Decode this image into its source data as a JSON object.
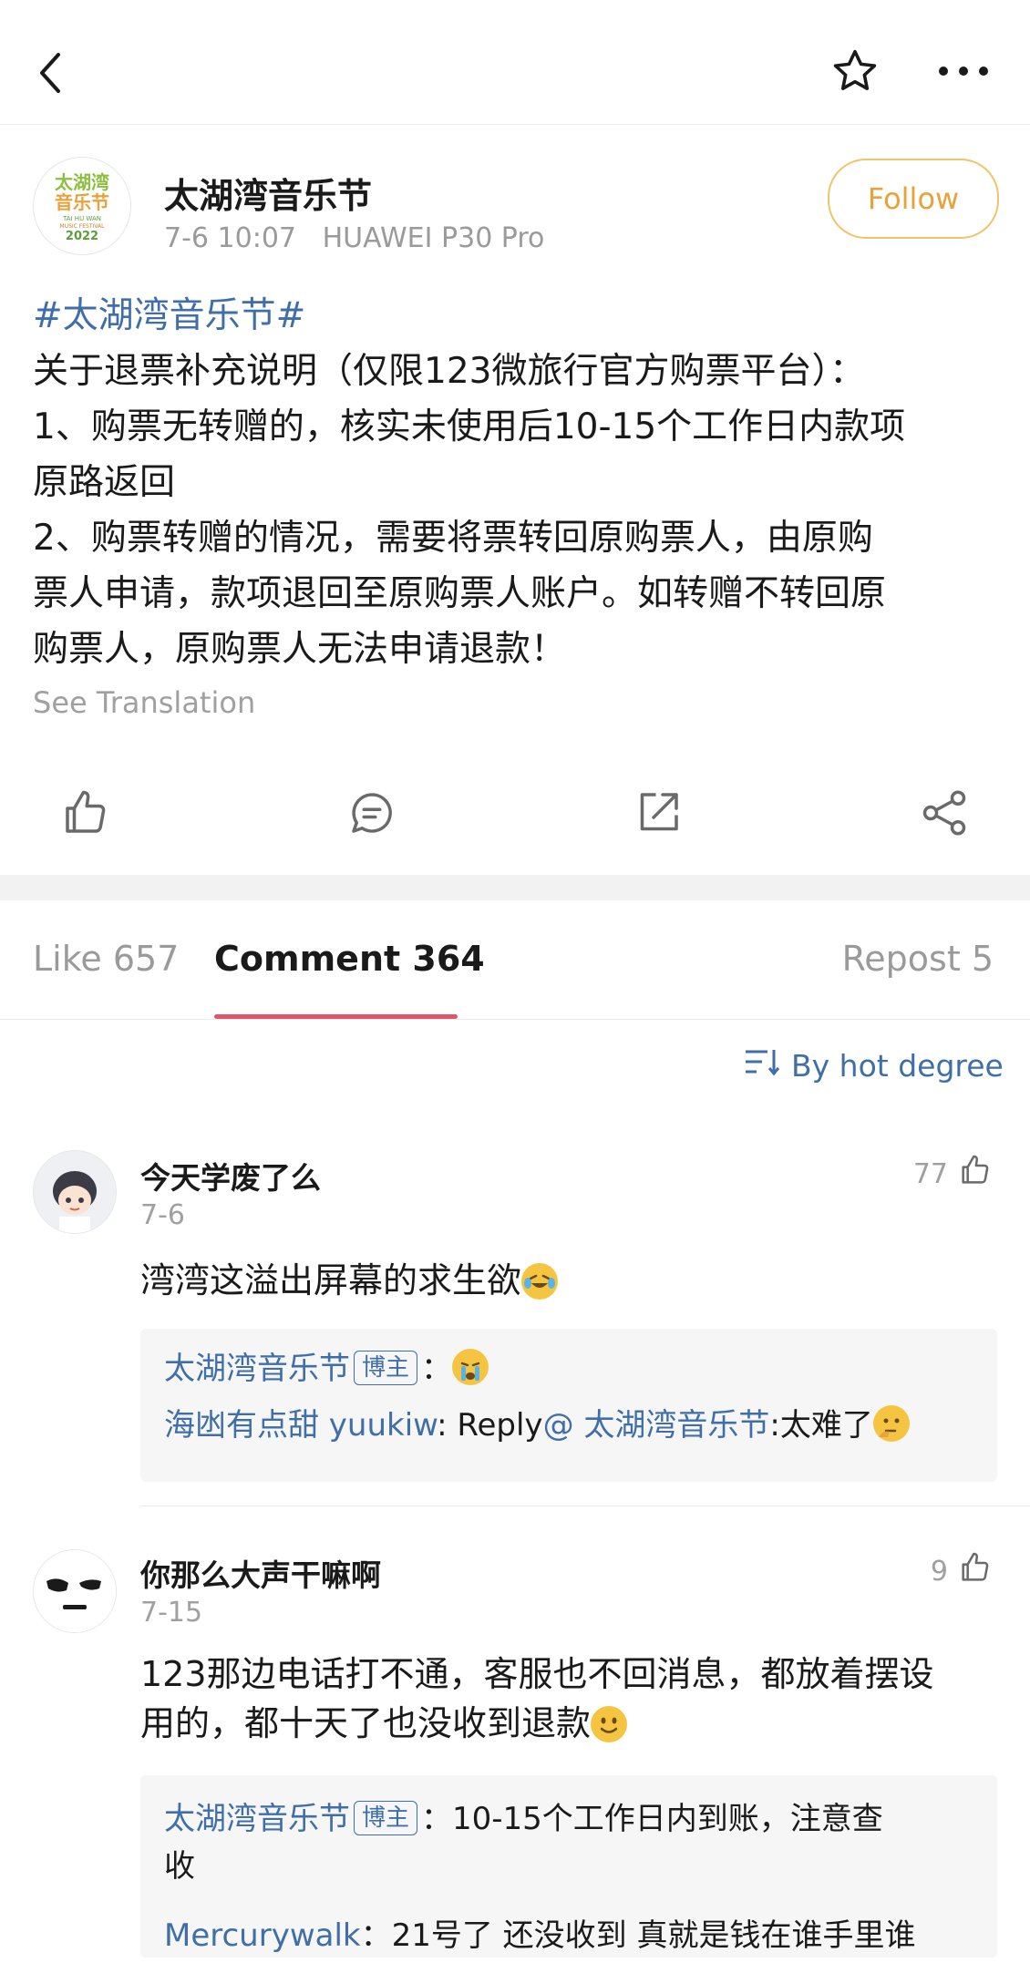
{
  "topbar": {
    "back_icon": "chevron-left-icon",
    "favorite_icon": "star-icon",
    "more_icon": "more-horizontal-icon"
  },
  "post": {
    "author": "太湖湾音乐节",
    "logo_lines": [
      "太湖湾",
      "音乐节",
      "TAI HU WAN",
      "MUSIC FESTIVAL",
      "2022"
    ],
    "date": "7-6 10:07",
    "device": "HUAWEI P30 Pro",
    "follow_label": "Follow",
    "hashtag": "#太湖湾音乐节#",
    "lines": [
      "关于退票补充说明（仅限123微旅行官方购票平台）：",
      "1、购票无转赠的，核实未使用后10-15个工作日内款项",
      "原路返回",
      "2、购票转赠的情况，需要将票转回原购票人，由原购",
      "票人申请，款项退回至原购票人账户。如转赠不转回原",
      "购票人，原购票人无法申请退款！"
    ],
    "see_translation": "See Translation"
  },
  "actions": [
    "like-icon",
    "comment-icon",
    "repost-icon",
    "share-icon"
  ],
  "tabs": {
    "like": "Like 657",
    "comment": "Comment 364",
    "repost": "Repost 5"
  },
  "sort_label": "By hot degree",
  "comments": [
    {
      "name": "今天学废了么",
      "date": "7-6",
      "likes": "77",
      "text": "湾湾这溢出屏幕的求生欲",
      "replies": [
        {
          "user": "太湖湾音乐节",
          "badge": "博主",
          "sep": "：",
          "text": ""
        },
        {
          "user": "海凼有点甜 yuukiw",
          "prefix": ": Reply",
          "mention": "@ 太湖湾音乐节",
          "text": ":太难了"
        }
      ]
    },
    {
      "name": "你那么大声干嘛啊",
      "date": "7-15",
      "likes": "9",
      "lines": [
        "123那边电话打不通，客服也不回消息，都放着摆设",
        "用的，都十天了也没收到退款"
      ],
      "replies": [
        {
          "user": "太湖湾音乐节",
          "badge": "博主",
          "text": "：10-15个工作日内到账，注意查",
          "text2": "收"
        },
        {
          "user": "Mercurywalk",
          "text": "：21号了 还没收到 真就是钱在谁手里谁"
        }
      ]
    }
  ],
  "colors": {
    "link": "#3f6ea8",
    "follow": "#e8a23a",
    "tab_underline": "#e0556a"
  }
}
